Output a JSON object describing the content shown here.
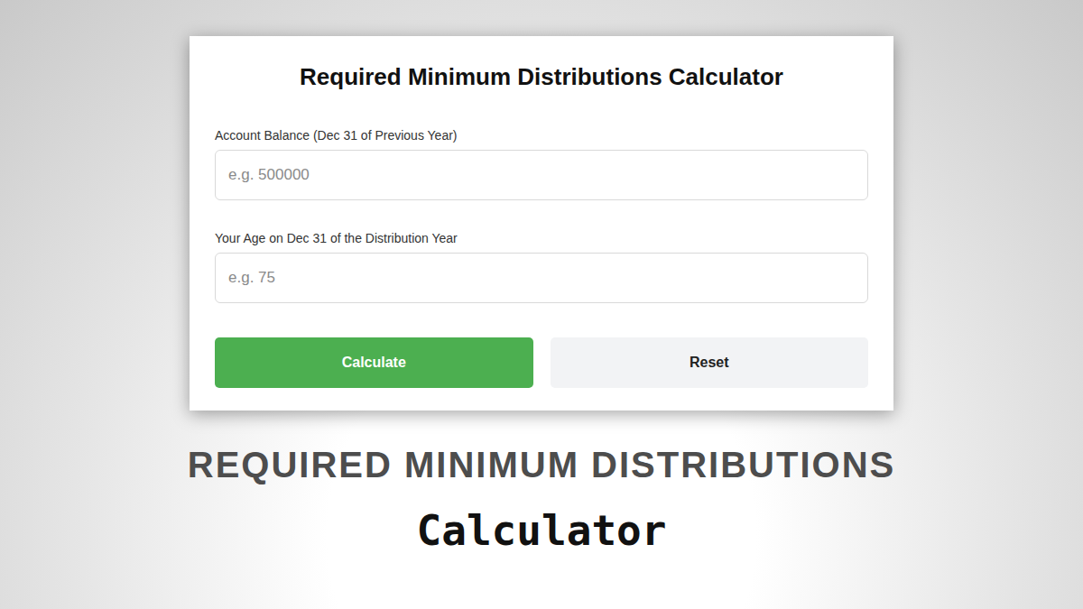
{
  "card": {
    "title": "Required Minimum Distributions Calculator",
    "fields": [
      {
        "label": "Account Balance (Dec 31 of Previous Year)",
        "placeholder": "e.g. 500000"
      },
      {
        "label": "Your Age on Dec 31 of the Distribution Year",
        "placeholder": "e.g. 75"
      }
    ],
    "buttons": [
      {
        "label": "Calculate",
        "kind": "primary"
      },
      {
        "label": "Reset",
        "kind": "secondary"
      }
    ]
  },
  "banner": {
    "heading": "REQUIRED MINIMUM DISTRIBUTIONS",
    "subheading": "Calculator"
  }
}
